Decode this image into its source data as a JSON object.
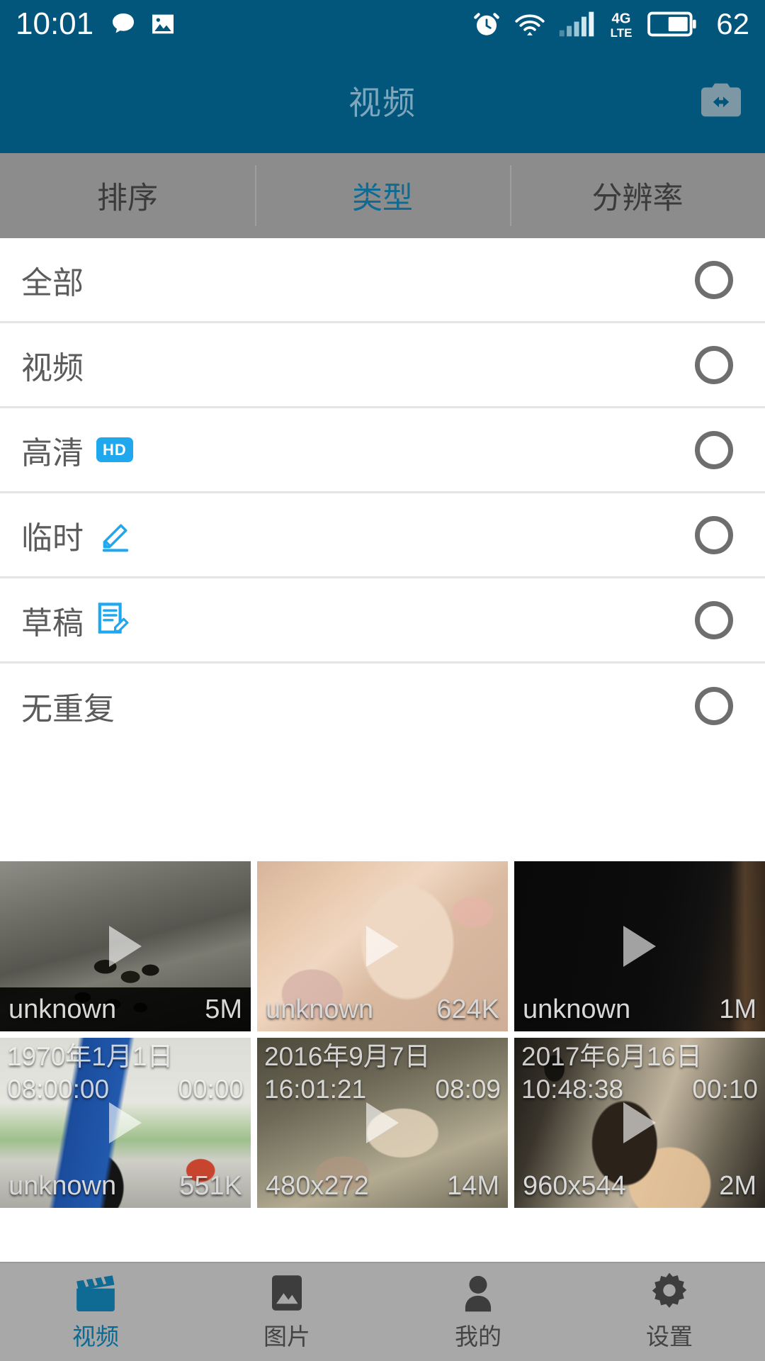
{
  "status_bar": {
    "time": "10:01",
    "battery_level": "62",
    "network_type": "4G",
    "network_sub": "LTE",
    "icons": [
      "message-icon",
      "gallery-icon",
      "alarm-icon",
      "wifi-icon",
      "signal-icon",
      "battery-icon"
    ]
  },
  "header": {
    "title": "视频",
    "action_icon": "camera-switch-icon"
  },
  "filter_tabs": [
    {
      "label": "排序",
      "active": false,
      "name": "tab-sort"
    },
    {
      "label": "类型",
      "active": true,
      "name": "tab-type"
    },
    {
      "label": "分辨率",
      "active": false,
      "name": "tab-resolution"
    }
  ],
  "options": [
    {
      "label": "全部",
      "badge": null,
      "selected": false
    },
    {
      "label": "视频",
      "badge": null,
      "selected": false
    },
    {
      "label": "高清",
      "badge": "HD",
      "selected": false
    },
    {
      "label": "临时",
      "badge": "pencil-icon",
      "selected": false
    },
    {
      "label": "草稿",
      "badge": "draft-icon",
      "selected": false
    },
    {
      "label": "无重复",
      "badge": null,
      "selected": false
    }
  ],
  "videos": [
    {
      "title": "unknown",
      "size": "5M",
      "date": null,
      "time": null,
      "duration": null,
      "art": "ducks-stairs"
    },
    {
      "title": "unknown",
      "size": "624K",
      "date": null,
      "time": null,
      "duration": null,
      "art": "woman-bed"
    },
    {
      "title": "unknown",
      "size": "1M",
      "date": null,
      "time": null,
      "duration": null,
      "art": "dark-room"
    },
    {
      "title": "unknown",
      "size": "551K",
      "date": "1970年1月1日",
      "time": "08:00:00",
      "duration": "00:00",
      "art": "phone-hand"
    },
    {
      "title": "480x272",
      "size": "14M",
      "date": "2016年9月7日",
      "time": "16:01:21",
      "duration": "08:09",
      "art": "bedroom"
    },
    {
      "title": "960x544",
      "size": "2M",
      "date": "2017年6月16日",
      "time": "10:48:38",
      "duration": "00:10",
      "art": "hallway"
    }
  ],
  "bottom_nav": [
    {
      "label": "视频",
      "icon": "film-icon",
      "active": true
    },
    {
      "label": "图片",
      "icon": "image-icon",
      "active": false
    },
    {
      "label": "我的",
      "icon": "person-icon",
      "active": false
    },
    {
      "label": "设置",
      "icon": "gear-icon",
      "active": false
    }
  ],
  "colors": {
    "header_bg": "#02567c",
    "accent_blue": "#1fa8ee",
    "tab_active": "#0f6b93",
    "tabs_bg": "#8c8c8c",
    "nav_bg": "#a8a8a8"
  }
}
